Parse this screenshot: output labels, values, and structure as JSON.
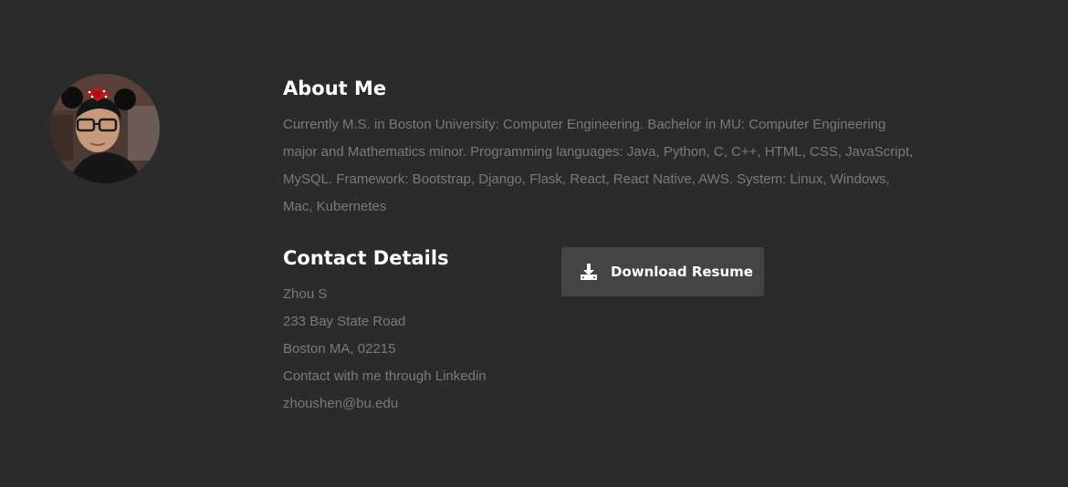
{
  "profile": {
    "avatar_icon": "profile-photo"
  },
  "about": {
    "heading": "About Me",
    "text": "Currently M.S. in Boston University: Computer Engineering. Bachelor in MU: Computer Engineering major and Mathematics minor. Programming languages: Java, Python, C, C++, HTML, CSS, JavaScript, MySQL. Framework: Bootstrap, Django, Flask, React, React Native, AWS. System: Linux, Windows, Mac, Kubernetes"
  },
  "contact": {
    "heading": "Contact Details",
    "lines": [
      "Zhou S",
      "233 Bay State Road",
      "Boston MA, 02215",
      "Contact with me through Linkedin",
      "zhoushen@bu.edu"
    ]
  },
  "download": {
    "label": "Download Resume",
    "icon": "download-icon"
  },
  "colors": {
    "background": "#2b2b2b",
    "text_muted": "#7a7a7a",
    "heading": "#ffffff",
    "button_bg": "#444444"
  }
}
